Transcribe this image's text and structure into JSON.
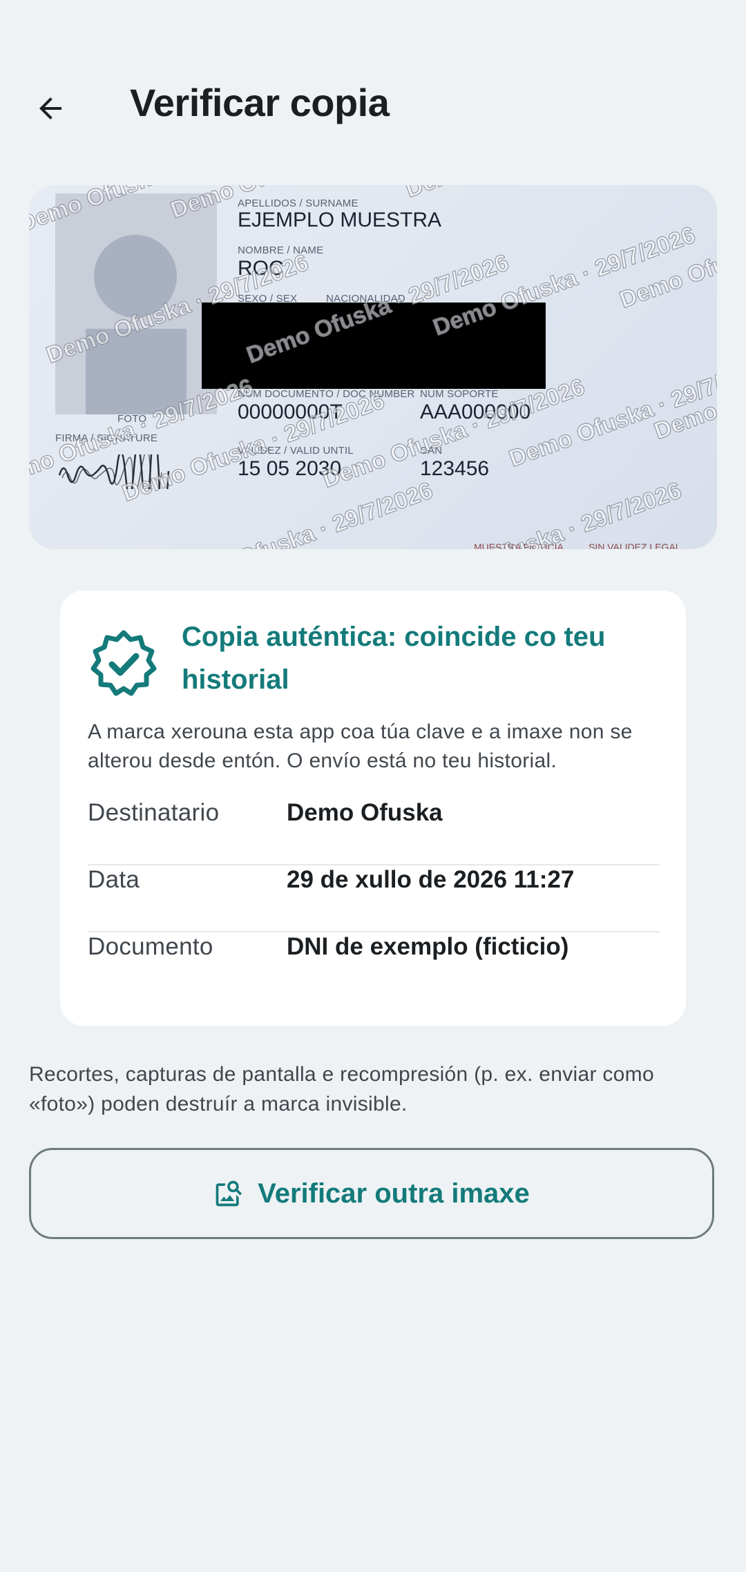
{
  "appbar": {
    "title": "Verificar copia",
    "back_icon": "arrow-back-icon"
  },
  "id_card": {
    "surname_label": "APELLIDOS / SURNAME",
    "surname": "EJEMPLO MUESTRA",
    "name_label": "NOMBRE / NAME",
    "name": "ROC",
    "sex_label": "SEXO / SEX",
    "nationality_label": "NACIONALIDAD",
    "photo_label": "FOTO",
    "signature_label": "FIRMA / SIGNATURE",
    "doc_number_label": "NUM DOCUMENTO / DOC NUMBER",
    "doc_number": "00000000T",
    "support_label": "NUM SOPORTE",
    "support": "AAA000000",
    "validity_label": "VALIDEZ / VALID UNTIL",
    "validity": "15 05 2030",
    "can_label": "CAN",
    "can": "123456",
    "footer_left": "MUESTRA FICTICIA",
    "footer_right": "SIN VALIDEZ LEGAL",
    "watermark_text": "Demo Ofuska · 29/7/2026"
  },
  "result": {
    "icon": "verified-badge-icon",
    "title": "Copia auténtica: coincide co teu historial",
    "description": "A marca xerouna esta app coa túa clave e a imaxe non se alterou desde entón. O envío está no teu historial.",
    "rows": [
      {
        "label": "Destinatario",
        "value": "Demo Ofuska"
      },
      {
        "label": "Data",
        "value": "29 de xullo de 2026 11:27"
      },
      {
        "label": "Documento",
        "value": "DNI de exemplo (ficticio)"
      }
    ]
  },
  "note": "Recortes, capturas de pantalla e recompresión (p. ex. enviar como «foto») poden destruír a marca invisible.",
  "verify_button": {
    "label": "Verificar outra imaxe",
    "icon": "image-search-icon"
  },
  "colors": {
    "accent": "#147a7a",
    "background": "#eef2f4",
    "panel": "#ffffff"
  }
}
